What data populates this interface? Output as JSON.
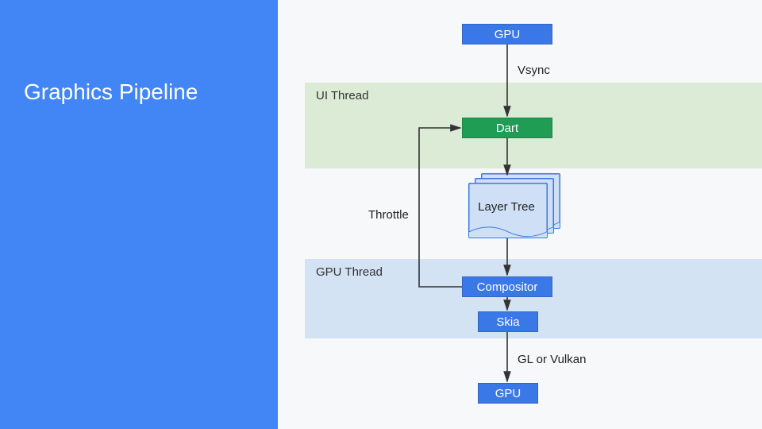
{
  "title": "Graphics Pipeline",
  "bands": {
    "ui": "UI Thread",
    "gpu": "GPU Thread"
  },
  "boxes": {
    "gpu_top": "GPU",
    "dart": "Dart",
    "layer_tree": "Layer Tree",
    "compositor": "Compositor",
    "skia": "Skia",
    "gpu_bot": "GPU"
  },
  "arrows": {
    "vsync": "Vsync",
    "throttle": "Throttle",
    "gl": "GL or Vulkan"
  },
  "colors": {
    "sidebar": "#4285f4",
    "blue_box": "#3b78e7",
    "green_box": "#1f9d55",
    "ui_band": "#dbebd6",
    "gpu_band": "#d4e3f4",
    "sheet_fill": "#cfe0f6"
  }
}
